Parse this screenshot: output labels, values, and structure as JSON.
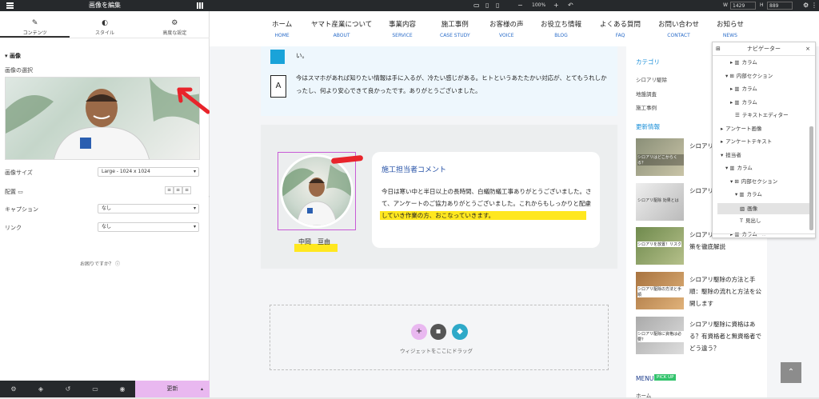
{
  "editor": {
    "title": "画像を編集",
    "tabs": [
      "コンテンツ",
      "スタイル",
      "高度な設定"
    ],
    "section_title": "画像",
    "image_choose_label": "画像の選択",
    "fields": [
      {
        "label": "画像サイズ",
        "value": "Large - 1024 x 1024"
      },
      {
        "label": "配置",
        "value": ""
      },
      {
        "label": "キャプション",
        "value": "なし"
      },
      {
        "label": "リンク",
        "value": "なし"
      }
    ],
    "help": "お困りですか？",
    "update_button": "更新"
  },
  "toolbar": {
    "zoom": "100%",
    "w_label": "W",
    "w_value": "1429",
    "h_label": "H",
    "h_value": "889"
  },
  "site_nav": [
    {
      "jp": "ホーム",
      "en": "HOME"
    },
    {
      "jp": "ヤマト産業について",
      "en": "ABOUT"
    },
    {
      "jp": "事業内容",
      "en": "SERVICE"
    },
    {
      "jp": "施工事例",
      "en": "CASE STUDY"
    },
    {
      "jp": "お客様の声",
      "en": "VOICE"
    },
    {
      "jp": "お役立ち情報",
      "en": "BLOG"
    },
    {
      "jp": "よくある質問",
      "en": "FAQ"
    },
    {
      "jp": "お問い合わせ",
      "en": "CONTACT"
    },
    {
      "jp": "お知らせ",
      "en": "NEWS"
    }
  ],
  "review": {
    "fragment": "い。",
    "badge": "A",
    "text": "今はスマホがあれば知りたい情報は手に入るが、冷たい感じがある。ヒトというあたたかい対応が、とてもうれしかったし、何より安心できて良かったです。ありがとうございました。"
  },
  "staff": {
    "name": "中岡　亘由",
    "comment_title": "施工担当者コメント",
    "comment_text": "今日は寒い中と半日以上の長時間、白蟻防蟻工事ありがとうございました。さて、アンケートのご協力ありがとうございました。これからもしっかりと配慮していき作業の方、おこなっていきます。"
  },
  "drop_zone": {
    "text": "ウィジェットをここにドラッグ"
  },
  "sidebar": {
    "category_heading": "カテゴリ",
    "categories": [
      "シロアリ駆除",
      "地盤調査",
      "施工事例"
    ],
    "news_heading": "更新情報",
    "news": [
      {
        "title": "シロアリ 中に入... を防ぐ..."
      },
      {
        "title": "シロアリ 果とは... できる..."
      },
      {
        "title": "シロアリ 場合のリスクと対策を徹底解説"
      },
      {
        "title": "シロアリ駆除の方法と手順：駆除の流れと方法を公開します"
      },
      {
        "title": "シロアリ駆除に資格はある？有資格者と無資格者でどう違う？"
      }
    ],
    "thumb_captions": [
      "シロアリはどこからくる？",
      "シロアリ駆除 効果とは",
      "シロアリを放置！リスク",
      "シロアリ駆除の方法と手順",
      "シロアリ駆除に資格は必要？"
    ],
    "menu_label": "MENU",
    "pickup_badge": "PICK UP",
    "menu_item": "ホーム"
  },
  "navigator": {
    "title": "ナビゲーター",
    "items": [
      {
        "label": "カラム",
        "indent": 3,
        "icon": "▸ ▥"
      },
      {
        "label": "内部セクション",
        "indent": 2,
        "icon": "▾ ⊞"
      },
      {
        "label": "カラム",
        "indent": 3,
        "icon": "▸ ▥"
      },
      {
        "label": "カラム",
        "indent": 3,
        "icon": "▸ ▥"
      },
      {
        "label": "テキストエディター",
        "indent": 4,
        "icon": "☰"
      },
      {
        "label": "アンケート画像",
        "indent": 1,
        "icon": "▸"
      },
      {
        "label": "アンケートテキスト",
        "indent": 1,
        "icon": "▸"
      },
      {
        "label": "担当者",
        "indent": 1,
        "icon": "▾"
      },
      {
        "label": "カラム",
        "indent": 2,
        "icon": "▾ ▥"
      },
      {
        "label": "内部セクション",
        "indent": 3,
        "icon": "▾ ⊞"
      },
      {
        "label": "カラム",
        "indent": 4,
        "icon": "▾ ▥"
      },
      {
        "label": "画像",
        "indent": 5,
        "icon": "▧"
      },
      {
        "label": "見出し",
        "indent": 5,
        "icon": "T"
      },
      {
        "label": "カラム",
        "indent": 3,
        "icon": "▸ ▥"
      }
    ],
    "selected": "画像"
  },
  "colors": {
    "accent": "#e9b8f0",
    "panel_dark": "#26292c",
    "nav_en": "#2a6cc9",
    "highlight": "#ffe71f"
  }
}
